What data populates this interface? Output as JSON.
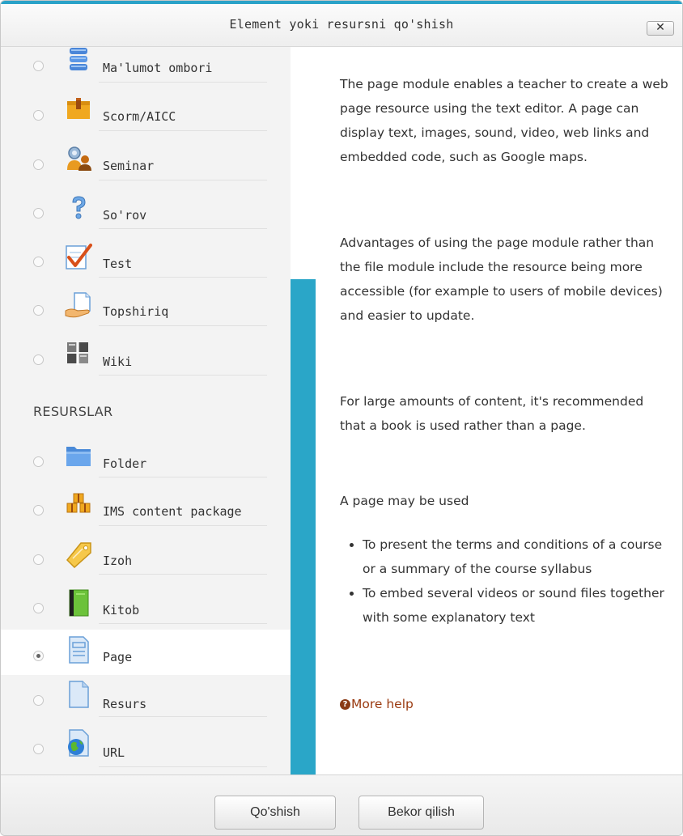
{
  "dialog": {
    "title": "Element yoki resursni qo'shish",
    "close_label": "✕"
  },
  "modules_activities": [
    {
      "label": "Ma'lumot ombori",
      "icon": "database-icon",
      "selected": false
    },
    {
      "label": "Scorm/AICC",
      "icon": "scorm-package-icon",
      "selected": false
    },
    {
      "label": "Seminar",
      "icon": "workshop-people-icon",
      "selected": false
    },
    {
      "label": "So'rov",
      "icon": "question-mark-icon",
      "selected": false
    },
    {
      "label": "Test",
      "icon": "quiz-check-icon",
      "selected": false
    },
    {
      "label": "Topshiriq",
      "icon": "assignment-hand-icon",
      "selected": false
    },
    {
      "label": "Wiki",
      "icon": "wiki-icon",
      "selected": false
    }
  ],
  "resources_heading": "RESURSLAR",
  "modules_resources": [
    {
      "label": "Folder",
      "icon": "folder-icon",
      "selected": false
    },
    {
      "label": "IMS content package",
      "icon": "ims-package-icon",
      "selected": false
    },
    {
      "label": "Izoh",
      "icon": "label-tag-icon",
      "selected": false
    },
    {
      "label": "Kitob",
      "icon": "book-icon",
      "selected": false
    },
    {
      "label": "Page",
      "icon": "page-icon",
      "selected": true
    },
    {
      "label": "Resurs",
      "icon": "file-icon",
      "selected": false
    },
    {
      "label": "URL",
      "icon": "globe-icon",
      "selected": false
    }
  ],
  "help": {
    "p1": "The page module enables a teacher to create a web page resource using the text editor. A page can display text, images, sound, video, web links and embedded code, such as Google maps.",
    "p2": "Advantages of using the page module rather than the file module include the resource being more accessible (for example to users of mobile devices) and easier to update.",
    "p3": "For large amounts of content, it's recommended that a book is used rather than a page.",
    "p4": "A page may be used",
    "bullets": [
      "To present the terms and conditions of a course or a summary of the course syllabus",
      "To embed several videos or sound files together with some explanatory text"
    ],
    "more_help": "More help",
    "more_help_icon_glyph": "?"
  },
  "footer": {
    "add_label": "Qo'shish",
    "cancel_label": "Bekor qilish"
  },
  "colors": {
    "accent": "#2aa6c8",
    "more_help": "#9a3a10"
  }
}
